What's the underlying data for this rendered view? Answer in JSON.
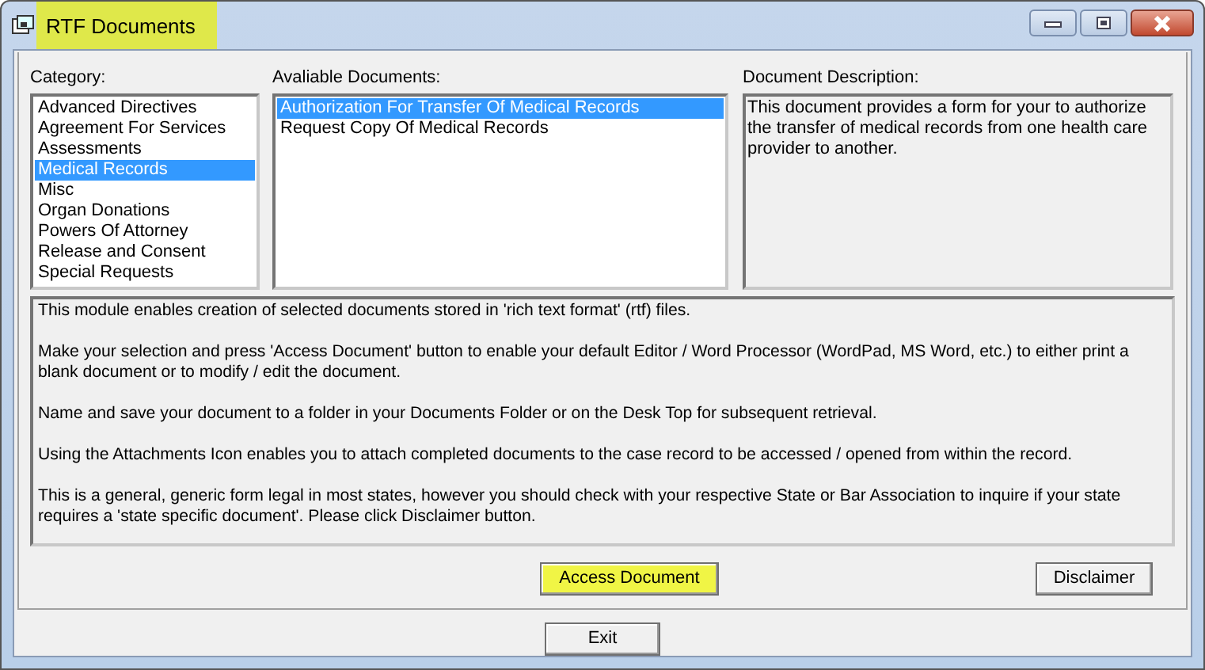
{
  "window": {
    "title": "RTF Documents",
    "title_highlighted": true
  },
  "category": {
    "label": "Category:",
    "items": [
      {
        "text": "Advanced Directives",
        "selected": false
      },
      {
        "text": "Agreement For Services",
        "selected": false
      },
      {
        "text": "Assessments",
        "selected": false
      },
      {
        "text": "Medical Records",
        "selected": true
      },
      {
        "text": "Misc",
        "selected": false
      },
      {
        "text": "Organ Donations",
        "selected": false
      },
      {
        "text": "Powers Of Attorney",
        "selected": false
      },
      {
        "text": "Release and Consent",
        "selected": false
      },
      {
        "text": "Special Requests",
        "selected": false
      }
    ]
  },
  "documents": {
    "label": "Avaliable Documents:",
    "items": [
      {
        "text": "Authorization For Transfer Of Medical Records",
        "selected": true
      },
      {
        "text": "Request Copy Of Medical Records",
        "selected": false
      }
    ]
  },
  "description": {
    "label": "Document Description:",
    "text": "This document provides a form for your to authorize the transfer of medical records from one health care provider to another."
  },
  "info": [
    "This module enables creation of selected documents stored in 'rich text format' (rtf) files.",
    "Make your selection and press 'Access Document' button to enable your default Editor / Word Processor (WordPad, MS Word, etc.) to either print a blank document or to modify / edit the document.",
    "Name and save your document to a folder in your Documents Folder or on the Desk Top for subsequent retrieval.",
    "Using the Attachments Icon enables you to attach completed documents to the case record to be accessed / opened from within the record.",
    "This is a general, generic form legal in most states, however you should check with your respective State or Bar Association to inquire if your state requires a 'state specific document'. Please click Disclaimer button."
  ],
  "buttons": [
    {
      "label": "Access Document",
      "highlighted": true
    },
    {
      "label": "Disclaimer",
      "highlighted": false
    }
  ],
  "exit_button": {
    "label": "Exit"
  }
}
